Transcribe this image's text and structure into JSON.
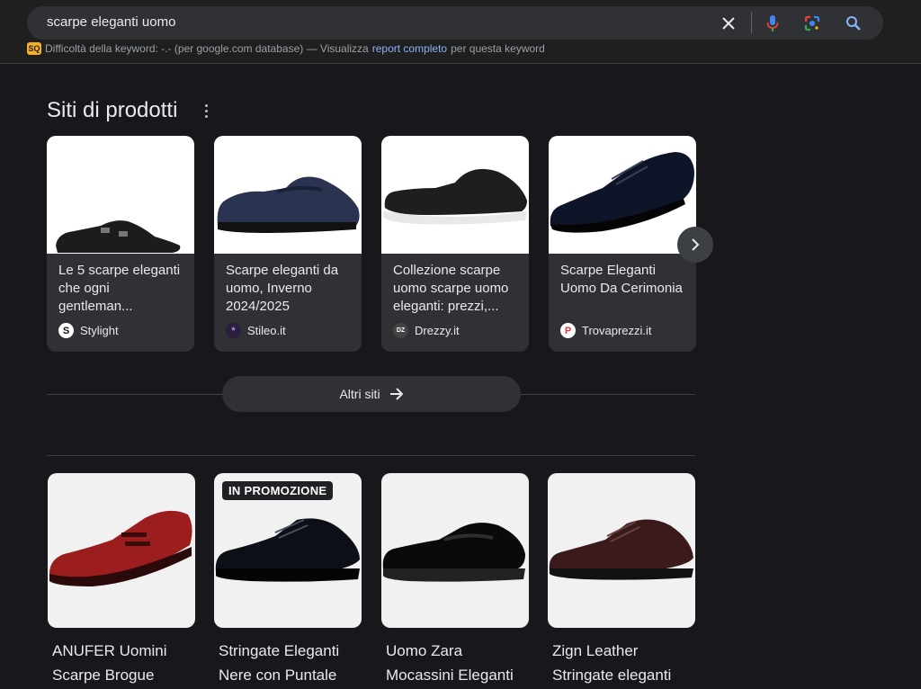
{
  "search": {
    "query": "scarpe eleganti uomo",
    "clear_icon": "close-icon",
    "mic_icon": "mic-icon",
    "lens_icon": "lens-icon",
    "search_icon": "search-icon"
  },
  "keyword_bar": {
    "badge": "SQ",
    "text_before": "Difficoltà della keyword: -.- (per google.com database) — Visualizza",
    "link": "report completo",
    "text_after": "per questa keyword"
  },
  "product_sites": {
    "title": "Siti di prodotti",
    "cards": [
      {
        "title": "Le 5 scarpe eleganti che ogni gentleman...",
        "source": "Stylight",
        "favicon": "S"
      },
      {
        "title": "Scarpe eleganti da uomo, Inverno 2024/2025",
        "source": "Stileo.it",
        "favicon": "*"
      },
      {
        "title": "Collezione scarpe uomo scarpe uomo eleganti: prezzi,...",
        "source": "Drezzy.it",
        "favicon": "DZ"
      },
      {
        "title": "Scarpe Eleganti Uomo Da Cerimonia",
        "source": "Trovaprezzi.it",
        "favicon": "P"
      }
    ],
    "more_label": "Altri siti"
  },
  "products": [
    {
      "title": "ANUFER Uomini Scarpe Brogue",
      "badge": ""
    },
    {
      "title": "Stringate Eleganti Nere con Puntale",
      "badge": "IN PROMOZIONE"
    },
    {
      "title": "Uomo Zara Mocassini Eleganti",
      "badge": ""
    },
    {
      "title": "Zign Leather Stringate eleganti",
      "badge": ""
    }
  ],
  "colors": {
    "background": "#18181c",
    "card": "#303134",
    "link": "#8ab4f8"
  }
}
